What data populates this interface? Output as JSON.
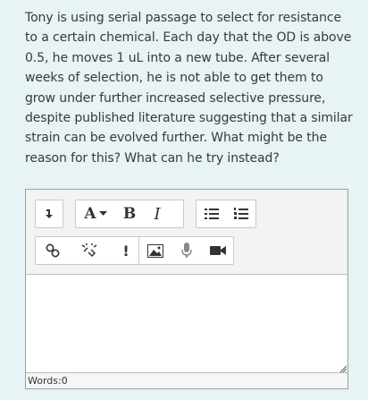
{
  "question": {
    "text": "Tony is using serial passage to select for resistance to a certain chemical. Each day that the OD is above 0.5, he moves 1 uL into a new tube. After several weeks of selection, he is not able to get them to grow under further increased selective pressure, despite published literature suggesting that a similar strain can be evolved further. What might be the reason for this? What can he try instead?"
  },
  "toolbar": {
    "font_label": "A",
    "bold_label": "B",
    "italic_label": "I",
    "exclaim_label": "!"
  },
  "editor": {
    "answer_value": "",
    "word_count_label": "Words:0"
  }
}
